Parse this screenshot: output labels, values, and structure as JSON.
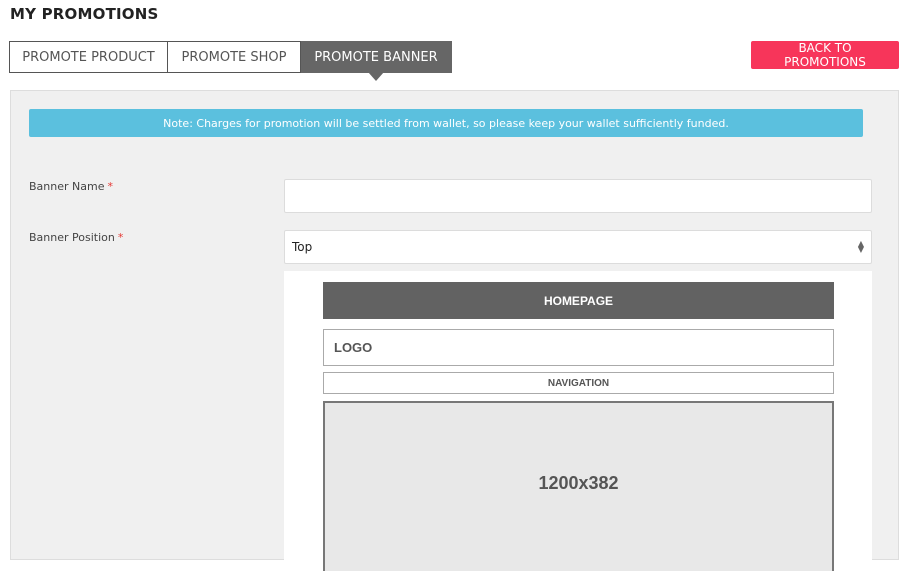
{
  "page": {
    "title": "MY PROMOTIONS"
  },
  "tabs": [
    {
      "label": "PROMOTE PRODUCT",
      "active": false
    },
    {
      "label": "PROMOTE SHOP",
      "active": false
    },
    {
      "label": "PROMOTE BANNER",
      "active": true
    }
  ],
  "back_button": {
    "label": "BACK TO PROMOTIONS"
  },
  "note": {
    "text": "Note: Charges for promotion will be settled from wallet, so please keep your wallet sufficiently funded."
  },
  "form": {
    "banner_name": {
      "label": "Banner Name",
      "required_mark": "*",
      "value": ""
    },
    "banner_position": {
      "label": "Banner Position",
      "required_mark": "*",
      "value": "Top",
      "arrows_up": "▲",
      "arrows_down": "▼"
    }
  },
  "preview": {
    "homepage": "HOMEPAGE",
    "logo": "LOGO",
    "navigation": "NAVIGATION",
    "banner_size": "1200x382"
  },
  "colors": {
    "accent_button": "#f7355a",
    "note_bg": "#5bc0de",
    "active_tab": "#666666"
  }
}
